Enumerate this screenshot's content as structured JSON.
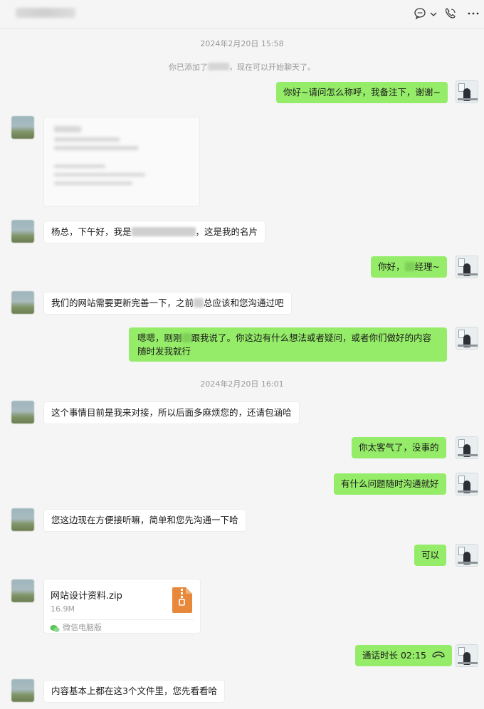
{
  "header": {
    "icons": [
      "chat-bubble-icon",
      "chevron-down-icon",
      "phone-icon",
      "more-icon"
    ]
  },
  "timestamps": [
    "2024年2月20日 15:58",
    "2024年2月20日 16:01"
  ],
  "system": {
    "before": "你已添加了",
    "after": "，现在可以开始聊天了。"
  },
  "messages": {
    "m1": "你好~请问怎么称呼，我备注下，谢谢~",
    "m3a": "杨总，下午好，我是",
    "m3b": "，这是我的名片",
    "m4a": "你好，",
    "m4b": "经理~",
    "m5a": "我们的网站需要更新完善一下，之前",
    "m5b": "总应该和您沟通过吧",
    "m6a": "嗯嗯，刚刚",
    "m6b": "跟我说了。你这边有什么想法或者疑问，或者你们做好的内容随",
    "m6c": "时发我就行",
    "m7": "这个事情目前是我来对接，所以后面多麻烦您的，还请包涵哈",
    "m8": "你太客气了，没事的",
    "m9": "有什么问题随时沟通就好",
    "m10": "您这边现在方便接听嘛，简单和您先沟通一下哈",
    "m11": "可以",
    "m13": "通话时长 02:15",
    "m14": "内容基本上都在这3个文件里，您先看看哈"
  },
  "file": {
    "name": "网站设计资料.zip",
    "size": "16.9M",
    "source": "微信电脑版",
    "icon": "zip-file-icon"
  },
  "colors": {
    "sent_bubble": "#95ec69",
    "received_bubble": "#ffffff",
    "background": "#f5f5f5",
    "zip_icon": "#e8883a"
  }
}
